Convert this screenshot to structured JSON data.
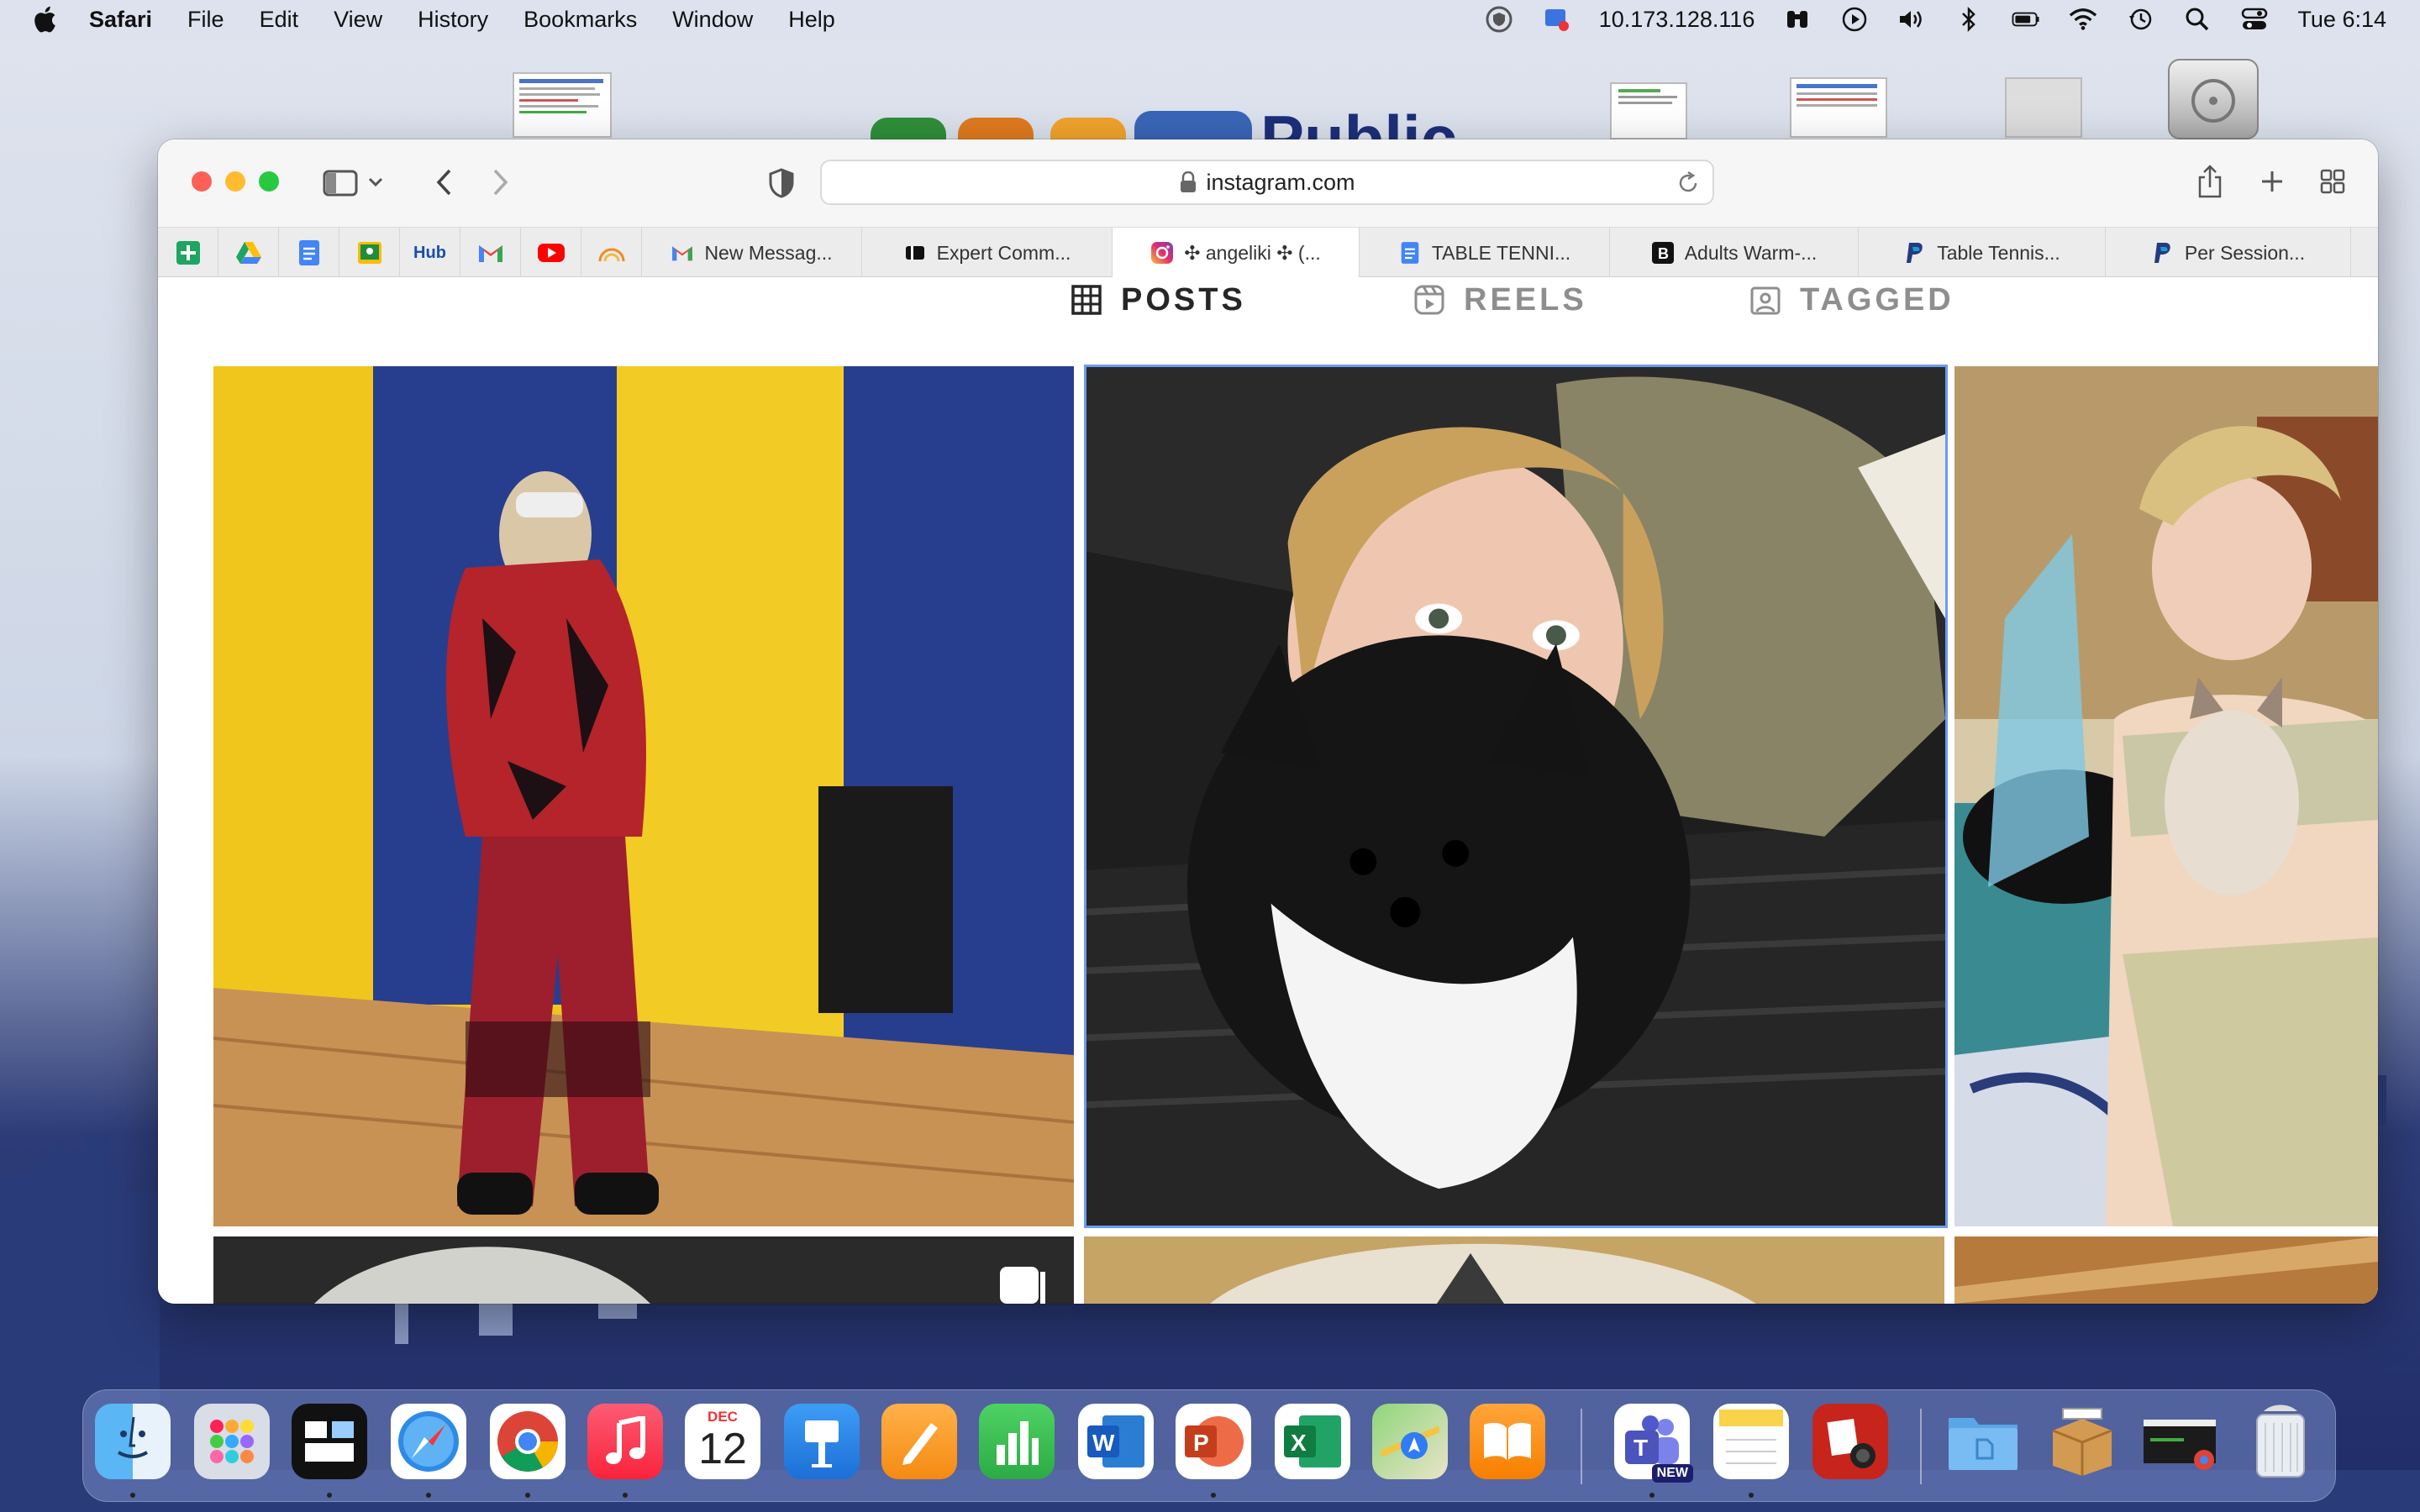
{
  "menubar": {
    "app_name": "Safari",
    "menus": [
      "File",
      "Edit",
      "View",
      "History",
      "Bookmarks",
      "Window",
      "Help"
    ],
    "ip_address": "10.173.128.116",
    "clock": "Tue 6:14"
  },
  "browser": {
    "url": "instagram.com",
    "favorites": [
      {
        "name": "google-sheets-icon",
        "label": ""
      },
      {
        "name": "google-drive-icon",
        "label": ""
      },
      {
        "name": "google-docs-icon",
        "label": ""
      },
      {
        "name": "google-classroom-icon",
        "label": ""
      },
      {
        "name": "wellness-hub-icon",
        "label": "Hub"
      },
      {
        "name": "gmail-icon",
        "label": ""
      },
      {
        "name": "youtube-icon",
        "label": ""
      },
      {
        "name": "rainbow-icon",
        "label": ""
      }
    ],
    "tabs": [
      {
        "title": "New Messag...",
        "icon": "gmail-icon",
        "active": false
      },
      {
        "title": "Expert Comm...",
        "icon": "expert-icon",
        "active": false
      },
      {
        "title": "✣ angeliki ✣ (...",
        "icon": "instagram-icon",
        "active": true
      },
      {
        "title": "TABLE TENNI...",
        "icon": "google-docs-icon",
        "active": false
      },
      {
        "title": "Adults Warm-...",
        "icon": "bold-b-icon",
        "active": false
      },
      {
        "title": "Table Tennis...",
        "icon": "paypal-icon",
        "active": false
      },
      {
        "title": "Per Session...",
        "icon": "paypal-icon",
        "active": false
      }
    ]
  },
  "profile_tabs": {
    "posts": "POSTS",
    "reels": "REELS",
    "tagged": "TAGGED"
  },
  "posts": [
    {
      "name": "post-person-hoodie-gym"
    },
    {
      "name": "post-girl-with-dog"
    },
    {
      "name": "post-woman-with-kitten"
    },
    {
      "name": "post-gray-hood"
    },
    {
      "name": "post-blonde-hair"
    },
    {
      "name": "post-wood-texture"
    }
  ],
  "dock": {
    "calendar_month": "DEC",
    "calendar_day": "12",
    "teams_badge": "NEW"
  },
  "colors": {
    "gym_yellow": "#f0c61c",
    "gym_blue": "#273e8e",
    "selection_blue": "#6b9cf0"
  }
}
